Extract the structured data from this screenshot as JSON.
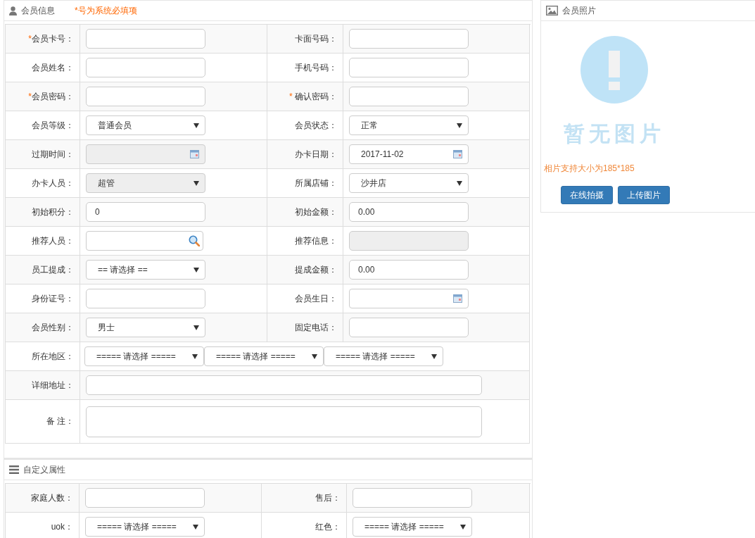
{
  "member_info": {
    "title": "会员信息",
    "required_note": "*号为系统必填项",
    "rows": [
      [
        {
          "label": "会员卡号：",
          "mark": "*",
          "kind": "text",
          "disabled": false
        },
        {
          "label": "卡面号码：",
          "kind": "text",
          "disabled": false
        }
      ],
      [
        {
          "label": "会员姓名：",
          "kind": "text",
          "disabled": false
        },
        {
          "label": "手机号码：",
          "kind": "text",
          "disabled": false
        }
      ],
      [
        {
          "label": "会员密码：",
          "mark": "*",
          "kind": "text",
          "disabled": false
        },
        {
          "label": "确认密码：",
          "mark": "* ",
          "kind": "text",
          "disabled": false
        }
      ],
      [
        {
          "label": "会员等级：",
          "kind": "select",
          "value": "普通会员",
          "disabled": false
        },
        {
          "label": "会员状态：",
          "kind": "select",
          "value": "正常",
          "disabled": false
        }
      ],
      [
        {
          "label": "过期时间：",
          "kind": "date",
          "disabled": true
        },
        {
          "label": "办卡日期：",
          "kind": "date",
          "value": "2017-11-02",
          "disabled": false
        }
      ],
      [
        {
          "label": "办卡人员：",
          "kind": "select",
          "value": "超管",
          "disabled": true
        },
        {
          "label": "所属店铺：",
          "kind": "select",
          "value": "沙井店",
          "disabled": false
        }
      ],
      [
        {
          "label": "初始积分：",
          "kind": "text",
          "value": "0",
          "disabled": false
        },
        {
          "label": "初始金额：",
          "kind": "text",
          "value": "0.00",
          "disabled": false
        }
      ],
      [
        {
          "label": "推荐人员：",
          "kind": "search",
          "disabled": false
        },
        {
          "label": "推荐信息：",
          "kind": "text",
          "disabled": true
        }
      ],
      [
        {
          "label": "员工提成：",
          "kind": "select",
          "value": "== 请选择 ==",
          "disabled": false
        },
        {
          "label": "提成金额：",
          "kind": "text",
          "value": "0.00",
          "disabled": false
        }
      ],
      [
        {
          "label": "身份证号：",
          "kind": "text",
          "disabled": false
        },
        {
          "label": "会员生日：",
          "kind": "date",
          "disabled": false
        }
      ],
      [
        {
          "label": "会员性别：",
          "kind": "select",
          "value": "男士",
          "disabled": false
        },
        {
          "label": "固定电话：",
          "kind": "text",
          "disabled": false
        }
      ]
    ],
    "region": {
      "label": "所在地区：",
      "selects": [
        "===== 请选择 =====",
        "===== 请选择 =====",
        "===== 请选择 ====="
      ]
    },
    "address": {
      "label": "详细地址："
    },
    "remarks": {
      "label": "备 注："
    }
  },
  "custom_attributes": {
    "title": "自定义属性",
    "rows": [
      [
        {
          "label": "家庭人数：",
          "kind": "text",
          "disabled": false
        },
        {
          "label": "售后：",
          "kind": "text",
          "disabled": false
        }
      ],
      [
        {
          "label": "uok：",
          "kind": "select",
          "value": "===== 请选择 =====",
          "disabled": false
        },
        {
          "label": "红色：",
          "kind": "select",
          "value": "===== 请选择 =====",
          "disabled": false
        }
      ]
    ]
  },
  "member_photo": {
    "title": "会员照片",
    "placeholder_text": "暂无图片",
    "hint": "相片支持大小为185*185",
    "buttons": [
      "在线拍摄",
      "上传图片"
    ]
  }
}
